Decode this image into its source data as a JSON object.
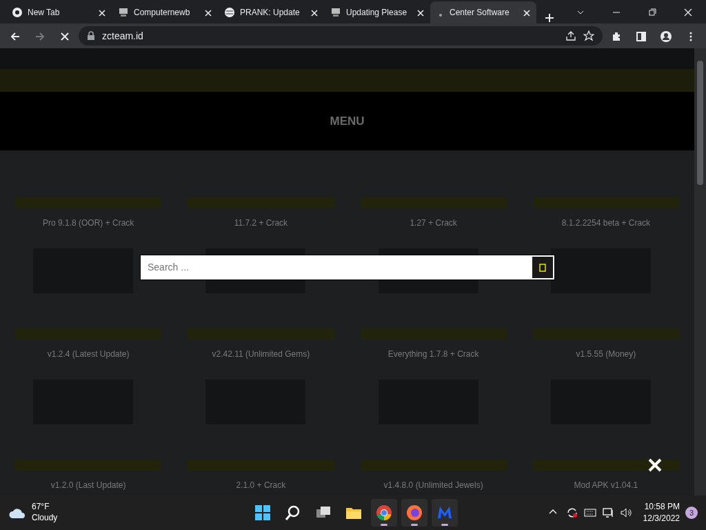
{
  "browser": {
    "tabs": [
      {
        "title": "New Tab",
        "selected": false
      },
      {
        "title": "Computernewb",
        "selected": false
      },
      {
        "title": "PRANK: Update",
        "selected": false
      },
      {
        "title": "Updating Please",
        "selected": false
      },
      {
        "title": "Center Software",
        "selected": true
      }
    ],
    "url": "zcteam.id",
    "loading": true
  },
  "page": {
    "menu_label": "MENU",
    "cards": [
      {
        "title": "Pro 9.1.8 (OOR) + Crack"
      },
      {
        "title": "11.7.2 + Crack"
      },
      {
        "title": "1.27 + Crack"
      },
      {
        "title": "8.1.2.2254 beta + Crack"
      },
      {
        "title": "v1.2.4 (Latest Update)"
      },
      {
        "title": "v2.42.11 (Unlimited Gems)"
      },
      {
        "title": "Everything 1.7.8 + Crack"
      },
      {
        "title": "v1.5.55 (Money)"
      },
      {
        "title": "v1.2.0 (Last Update)"
      },
      {
        "title": "2.1.0 + Crack"
      },
      {
        "title": "v1.4.8.0 (Unlimited Jewels)"
      },
      {
        "title": "Mod APK v1.04.1"
      }
    ]
  },
  "search_overlay": {
    "placeholder": "Search ..."
  },
  "taskbar": {
    "weather": {
      "temperature": "67°F",
      "condition": "Cloudy"
    },
    "apps": [
      {
        "kind": "start",
        "running": false
      },
      {
        "kind": "search",
        "running": false
      },
      {
        "kind": "taskview",
        "running": false
      },
      {
        "kind": "folder",
        "running": false
      },
      {
        "kind": "chrome",
        "running": true
      },
      {
        "kind": "firefox",
        "running": true
      },
      {
        "kind": "malware",
        "running": true
      }
    ],
    "time": "10:58 PM",
    "date": "12/3/2022",
    "notifications": "3"
  }
}
